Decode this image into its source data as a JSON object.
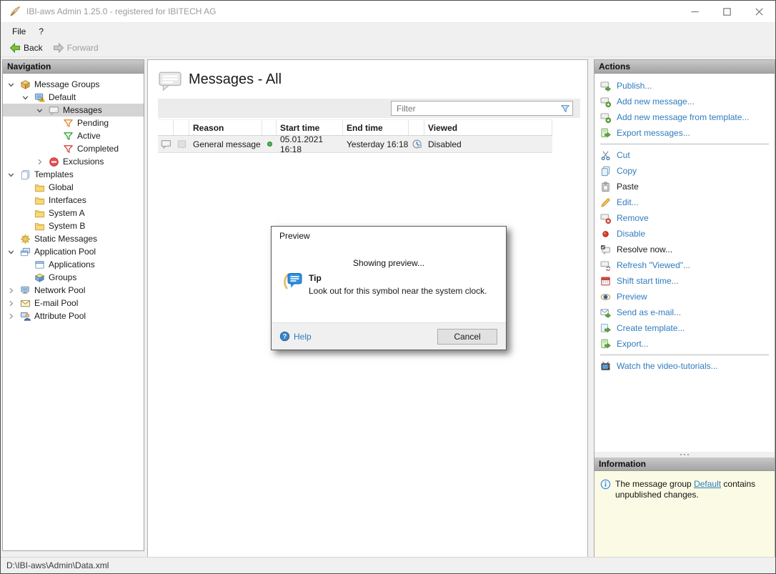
{
  "window": {
    "title": "IBI-aws Admin 1.25.0 - registered for IBITECH AG",
    "status_bar": "D:\\IBI-aws\\Admin\\Data.xml"
  },
  "menu_bar": {
    "file": "File",
    "help": "?"
  },
  "toolbar": {
    "back": "Back",
    "forward": "Forward"
  },
  "navigation_panel": {
    "header": "Navigation",
    "items": [
      {
        "label": "Message Groups",
        "icon": "package-icon"
      },
      {
        "label": "Default",
        "icon": "monitor-warning-icon"
      },
      {
        "label": "Messages",
        "icon": "message-icon"
      },
      {
        "label": "Pending",
        "icon": "funnel-orange-icon"
      },
      {
        "label": "Active",
        "icon": "funnel-green-icon"
      },
      {
        "label": "Completed",
        "icon": "funnel-red-icon"
      },
      {
        "label": "Exclusions",
        "icon": "no-entry-icon"
      },
      {
        "label": "Templates",
        "icon": "documents-icon"
      },
      {
        "label": "Global",
        "icon": "folder-icon"
      },
      {
        "label": "Interfaces",
        "icon": "folder-icon"
      },
      {
        "label": "System A",
        "icon": "folder-icon"
      },
      {
        "label": "System B",
        "icon": "folder-icon"
      },
      {
        "label": "Static Messages",
        "icon": "gear-icon"
      },
      {
        "label": "Application Pool",
        "icon": "windows-icon"
      },
      {
        "label": "Applications",
        "icon": "window-icon"
      },
      {
        "label": "Groups",
        "icon": "cube-icon"
      },
      {
        "label": "Network Pool",
        "icon": "monitor-icon"
      },
      {
        "label": "E-mail Pool",
        "icon": "envelope-icon"
      },
      {
        "label": "Attribute Pool",
        "icon": "person-icon"
      }
    ]
  },
  "content": {
    "title": "Messages - All",
    "filter_placeholder": "Filter",
    "table": {
      "col_reason": "Reason",
      "col_start": "Start time",
      "col_end": "End time",
      "col_viewed": "Viewed",
      "row": {
        "reason": "General message",
        "start": "05.01.2021 16:18",
        "end": "Yesterday 16:18",
        "viewed": "Disabled"
      }
    }
  },
  "actions_panel": {
    "header": "Actions",
    "items": [
      {
        "label": "Publish...",
        "icon": "message-publish-icon"
      },
      {
        "label": "Add new message...",
        "icon": "message-add-icon"
      },
      {
        "label": "Add new message from template...",
        "icon": "message-add-icon"
      },
      {
        "label": "Export messages...",
        "icon": "export-doc-icon"
      },
      {
        "label": "Cut",
        "icon": "scissors-icon"
      },
      {
        "label": "Copy",
        "icon": "copy-icon"
      },
      {
        "label": "Paste",
        "icon": "clipboard-icon"
      },
      {
        "label": "Edit...",
        "icon": "pencil-icon"
      },
      {
        "label": "Remove",
        "icon": "message-remove-icon"
      },
      {
        "label": "Disable",
        "icon": "red-dot-icon"
      },
      {
        "label": "Resolve now...",
        "icon": "message-check-icon"
      },
      {
        "label": "Refresh \"Viewed\"...",
        "icon": "message-refresh-icon"
      },
      {
        "label": "Shift start time...",
        "icon": "calendar-icon"
      },
      {
        "label": "Preview",
        "icon": "eye-icon"
      },
      {
        "label": "Send as e-mail...",
        "icon": "envelope-send-icon"
      },
      {
        "label": "Create template...",
        "icon": "template-create-icon"
      },
      {
        "label": "Export...",
        "icon": "export-doc-icon"
      },
      {
        "label": "Watch the video-tutorials...",
        "icon": "tv-icon"
      }
    ]
  },
  "information_panel": {
    "header": "Information",
    "text_before": "The message group ",
    "link_text": "Default",
    "text_after": " contains unpublished changes."
  },
  "dialog": {
    "title": "Preview",
    "status_text": "Showing preview...",
    "tip_title": "Tip",
    "tip_text": "Look out for this symbol near the system clock.",
    "help": "Help",
    "cancel": "Cancel"
  },
  "colors": {
    "link_blue": "#2f7cbe",
    "info_background": "#fbfbe5",
    "selection_gray": "#d4d4d4",
    "status_green": "#4db848"
  }
}
